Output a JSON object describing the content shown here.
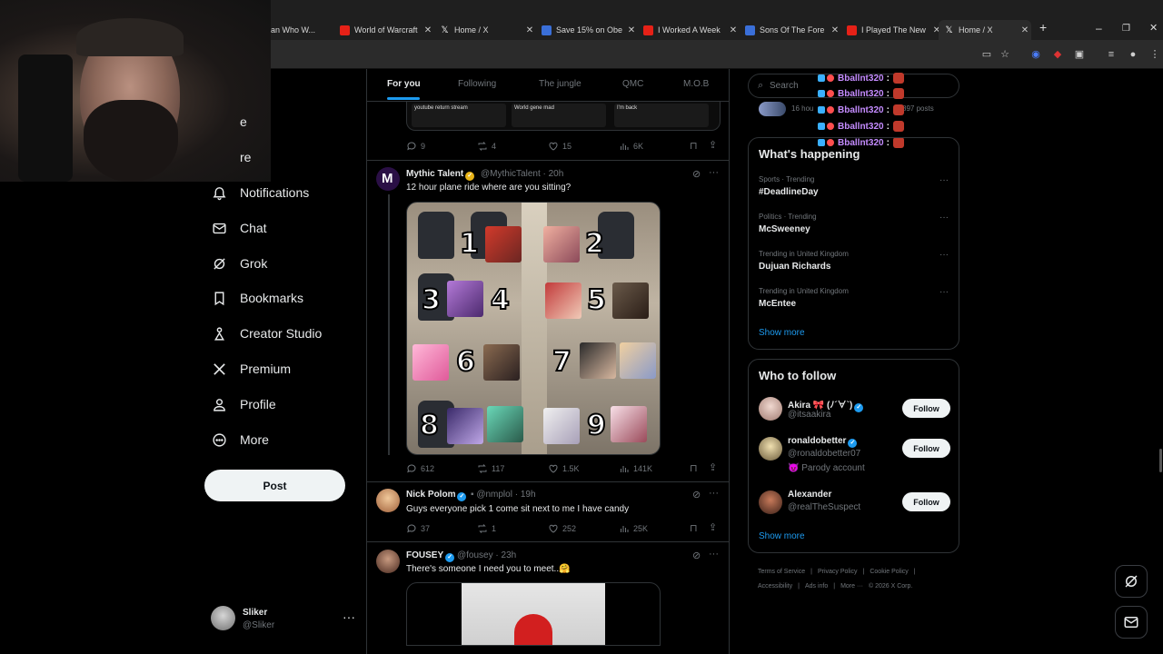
{
  "browser": {
    "tabs": [
      {
        "title": "an Who W...",
        "favicon": "youtube-icon",
        "active": false
      },
      {
        "title": "World of Warcraft",
        "favicon": "youtube-icon",
        "active": false
      },
      {
        "title": "Home / X",
        "favicon": "x-icon",
        "active": false
      },
      {
        "title": "Save 15% on Obe",
        "favicon": "steam-icon",
        "active": false
      },
      {
        "title": "I Worked A Week",
        "favicon": "youtube-icon",
        "active": false
      },
      {
        "title": "Sons Of The Fore",
        "favicon": "steam-icon",
        "active": false
      },
      {
        "title": "I Played The New",
        "favicon": "youtube-icon",
        "active": false
      },
      {
        "title": "Home / X",
        "favicon": "x-icon",
        "active": true
      }
    ],
    "new_tab": "+",
    "minimize": "–",
    "maximize": "❐",
    "close": "✕"
  },
  "sidebar": {
    "items": [
      {
        "label": "e",
        "icon": "home-icon"
      },
      {
        "label": "re",
        "icon": "explore-icon"
      },
      {
        "label": "Notifications",
        "icon": "bell-icon"
      },
      {
        "label": "Chat",
        "icon": "mail-icon"
      },
      {
        "label": "Grok",
        "icon": "grok-icon"
      },
      {
        "label": "Bookmarks",
        "icon": "bookmark-icon"
      },
      {
        "label": "Creator Studio",
        "icon": "creator-icon"
      },
      {
        "label": "Premium",
        "icon": "x-icon"
      },
      {
        "label": "Profile",
        "icon": "person-icon"
      },
      {
        "label": "More",
        "icon": "more-circle-icon"
      }
    ],
    "post_label": "Post",
    "account": {
      "name": "Sliker",
      "handle": "@Sliker",
      "more": "···"
    }
  },
  "feed": {
    "tabs": [
      "For you",
      "Following",
      "The jungle",
      "QMC",
      "M.O.B"
    ],
    "active_tab": 0,
    "prev_tweet_actions": {
      "replies": "9",
      "reposts": "4",
      "likes": "15",
      "views": "6K"
    },
    "prev_tweet_preview_lines": [
      "youtube return stream",
      "World gene mad",
      "I'm back"
    ],
    "tweets": [
      {
        "name": "Mythic Talent",
        "handle": "@MythicTalent",
        "time": "20h",
        "text": "12 hour plane ride where are you sitting?",
        "badge": "gold",
        "replies": "612",
        "reposts": "117",
        "likes": "1.5K",
        "views": "141K",
        "seat_numbers": [
          "1",
          "2",
          "3",
          "4",
          "5",
          "6",
          "7",
          "8",
          "9"
        ]
      },
      {
        "name": "Nick Polom",
        "handle": "@nmplol",
        "time": "19h",
        "text": "Guys everyone pick 1 come sit next to me I have candy",
        "badge": "blue",
        "replies": "37",
        "reposts": "1",
        "likes": "252",
        "views": "25K"
      },
      {
        "name": "FOUSEY",
        "handle": "@fousey",
        "time": "23h",
        "text": "There's someone I need you to meet..🤗",
        "badge": "blue"
      }
    ]
  },
  "right": {
    "search_placeholder": "Search",
    "chat_user": "Bballnt320",
    "chat_lines": 5,
    "top_card": {
      "time": "16 hou",
      "posts": "897 posts"
    },
    "happening": {
      "title": "What's happening",
      "trends": [
        {
          "category": "Sports · Trending",
          "name": "#DeadlineDay"
        },
        {
          "category": "Politics · Trending",
          "name": "McSweeney"
        },
        {
          "category": "Trending in United Kingdom",
          "name": "Dujuan Richards"
        },
        {
          "category": "Trending in United Kingdom",
          "name": "McEntee"
        }
      ],
      "show_more": "Show more"
    },
    "who_to_follow": {
      "title": "Who to follow",
      "users": [
        {
          "name": "Akira 🎀 (ﾉ´∀`)",
          "handle": "@itsaakira",
          "extra": ""
        },
        {
          "name": "ronaldobetter",
          "handle": "@ronaldobetter07",
          "extra": "😈 Parody account"
        },
        {
          "name": "Alexander",
          "handle": "@realTheSuspect",
          "extra": ""
        }
      ],
      "follow_label": "Follow",
      "show_more": "Show more"
    },
    "footer": [
      "Terms of Service",
      "|",
      "Privacy Policy",
      "|",
      "Cookie Policy",
      "|",
      "Accessibility",
      "|",
      "Ads info",
      "|",
      "More ···",
      "© 2026 X Corp."
    ]
  },
  "colors": {
    "accent": "#1d9bf0",
    "background": "#000000",
    "border": "#2f3336",
    "muted": "#71767b",
    "chat_name": "#c58cff"
  }
}
